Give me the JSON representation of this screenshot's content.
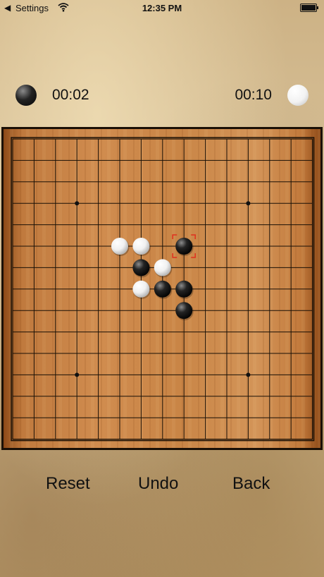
{
  "status_bar": {
    "back_label": "Settings",
    "time": "12:35 PM"
  },
  "players": {
    "black": {
      "color": "black",
      "time": "00:02"
    },
    "white": {
      "color": "white",
      "time": "00:10"
    }
  },
  "board": {
    "size": 15,
    "star_points": [
      [
        3,
        3
      ],
      [
        11,
        3
      ],
      [
        3,
        11
      ],
      [
        11,
        11
      ]
    ],
    "stones": [
      {
        "col": 5,
        "row": 5,
        "color": "white"
      },
      {
        "col": 6,
        "row": 5,
        "color": "white"
      },
      {
        "col": 8,
        "row": 5,
        "color": "black",
        "last_move": true
      },
      {
        "col": 6,
        "row": 6,
        "color": "black"
      },
      {
        "col": 7,
        "row": 6,
        "color": "white"
      },
      {
        "col": 6,
        "row": 7,
        "color": "white"
      },
      {
        "col": 7,
        "row": 7,
        "color": "black"
      },
      {
        "col": 8,
        "row": 7,
        "color": "black"
      },
      {
        "col": 8,
        "row": 8,
        "color": "black"
      }
    ],
    "last_move_marker_color": "#e0301e"
  },
  "buttons": {
    "reset": "Reset",
    "undo": "Undo",
    "back": "Back"
  }
}
